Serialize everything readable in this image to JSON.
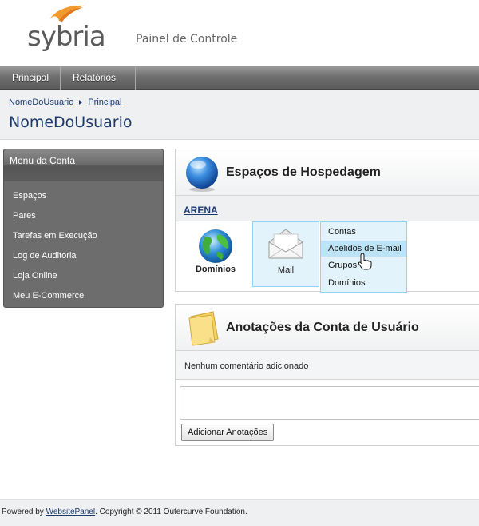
{
  "header": {
    "logo_text": "sybria",
    "panel_title": "Painel de Controle"
  },
  "topnav": {
    "items": [
      {
        "label": "Principal"
      },
      {
        "label": "Relatórios"
      }
    ]
  },
  "breadcrumb": {
    "items": [
      "NomeDoUsuario",
      "Principal"
    ]
  },
  "page_title": "NomeDoUsuario",
  "account_menu": {
    "title": "Menu da Conta",
    "items": [
      {
        "label": "Espaços"
      },
      {
        "label": "Pares"
      },
      {
        "label": "Tarefas em Execução"
      },
      {
        "label": "Log de Auditoria"
      },
      {
        "label": "Loja Online"
      },
      {
        "label": "Meu E-Commerce"
      }
    ]
  },
  "hosting": {
    "title": "Espaços de Hospedagem",
    "space_name": "ARENA",
    "tiles": [
      {
        "label": "Domínios",
        "icon": "globe-icon"
      },
      {
        "label": "Mail",
        "icon": "envelope-icon"
      }
    ],
    "mail_menu": [
      {
        "label": "Contas"
      },
      {
        "label": "Apelidos de E-mail"
      },
      {
        "label": "Grupos"
      },
      {
        "label": "Domínios"
      }
    ]
  },
  "notes": {
    "title": "Anotações da Conta de Usuário",
    "empty_text": "Nenhum comentário adicionado",
    "button_label": "Adicionar Anotações"
  },
  "footer": {
    "prefix": "Powered by ",
    "link": "WebsitePanel",
    "suffix": ". Copyright © 2011 Outercurve Foundation."
  },
  "colors": {
    "nav_bg": "#6f6f6f",
    "title_blue": "#1d3a6e",
    "highlight": "#bde3f6",
    "accent_orange": "#f39a2e"
  }
}
